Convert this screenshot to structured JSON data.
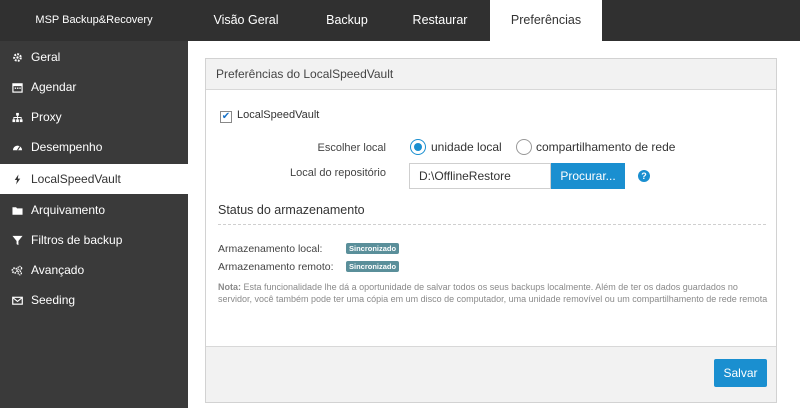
{
  "app": {
    "brand": "MSP Backup&Recovery"
  },
  "tabs": [
    {
      "label": "Visão Geral"
    },
    {
      "label": "Backup"
    },
    {
      "label": "Restaurar"
    },
    {
      "label": "Preferências",
      "active": true
    }
  ],
  "sidebar": {
    "items": [
      {
        "label": "Geral",
        "icon": "gear-icon"
      },
      {
        "label": "Agendar",
        "icon": "calendar-icon"
      },
      {
        "label": "Proxy",
        "icon": "network-icon"
      },
      {
        "label": "Desempenho",
        "icon": "dashboard-icon"
      },
      {
        "label": "LocalSpeedVault",
        "icon": "bolt-icon",
        "active": true
      },
      {
        "label": "Arquivamento",
        "icon": "folder-icon"
      },
      {
        "label": "Filtros de backup",
        "icon": "filter-icon"
      },
      {
        "label": "Avançado",
        "icon": "gears-icon"
      },
      {
        "label": "Seeding",
        "icon": "envelope-icon"
      }
    ]
  },
  "panel": {
    "title": "Preferências do LocalSpeedVault",
    "checkbox_label": "LocalSpeedVault",
    "checkbox_checked": true,
    "location_label": "Escolher local",
    "location_options": [
      "unidade local",
      "compartilhamento de rede"
    ],
    "location_selected": "unidade local",
    "repo_label": "Local do repositório",
    "repo_value": "D:\\OfflineRestore",
    "browse_label": "Procurar...",
    "status_title": "Status do armazenamento",
    "local_status_label": "Armazenamento local:",
    "local_status_value": "Sincronizado",
    "remote_status_label": "Armazenamento remoto:",
    "remote_status_value": "Sincronizado",
    "note_prefix": "Nota:",
    "note_text": "Esta funcionalidade lhe dá a oportunidade de salvar todos os seus backups localmente. Além de ter os dados guardados no servidor, você também pode ter uma cópia em um disco de computador, uma unidade removível ou um compartilhamento de rede remota",
    "save_label": "Salvar"
  },
  "colors": {
    "accent": "#1a8fd0",
    "topbar": "#303030",
    "sidebar": "#3a3a3a",
    "badge": "#5a8f9a"
  }
}
